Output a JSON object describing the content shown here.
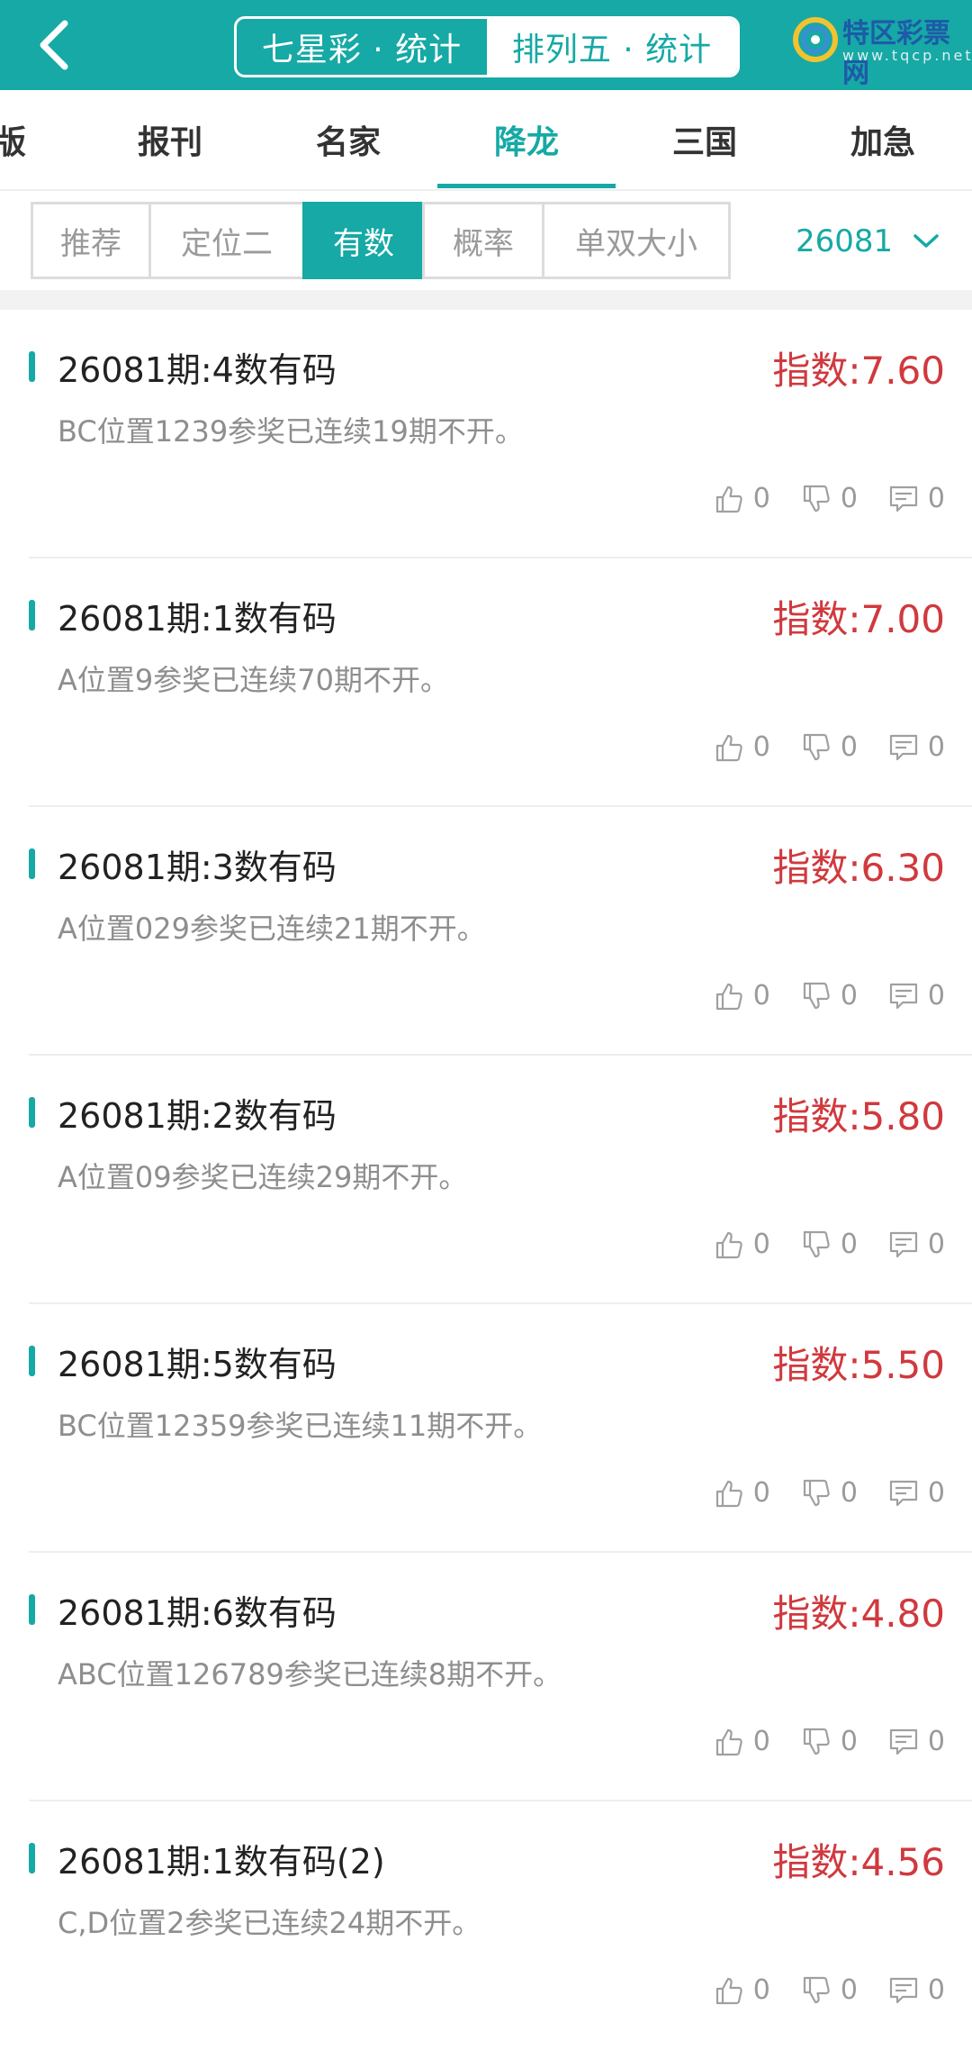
{
  "header": {
    "segments": [
      {
        "label": "七星彩 · 统计",
        "active": false
      },
      {
        "label": "排列五 · 统计",
        "active": true
      }
    ],
    "logo_text": "特区彩票网",
    "logo_sub": "www.tqcp.net"
  },
  "category_tabs": [
    {
      "label": "版",
      "active": false
    },
    {
      "label": "报刊",
      "active": false
    },
    {
      "label": "名家",
      "active": false
    },
    {
      "label": "降龙",
      "active": true
    },
    {
      "label": "三国",
      "active": false
    },
    {
      "label": "加急",
      "active": false
    }
  ],
  "sub_tabs": [
    {
      "label": "推荐",
      "active": false
    },
    {
      "label": "定位二",
      "active": false
    },
    {
      "label": "有数",
      "active": true
    },
    {
      "label": "概率",
      "active": false
    },
    {
      "label": "单双大小",
      "active": false
    }
  ],
  "period_select": {
    "value": "26081"
  },
  "colors": {
    "accent": "#16a9a5",
    "index_red": "#d0393e"
  },
  "items": [
    {
      "title": "26081期:4数有码",
      "index": "指数:7.60",
      "desc": "BC位置1239参奖已连续19期不开。",
      "likes": "0",
      "dislikes": "0",
      "comments": "0"
    },
    {
      "title": "26081期:1数有码",
      "index": "指数:7.00",
      "desc": "A位置9参奖已连续70期不开。",
      "likes": "0",
      "dislikes": "0",
      "comments": "0"
    },
    {
      "title": "26081期:3数有码",
      "index": "指数:6.30",
      "desc": "A位置029参奖已连续21期不开。",
      "likes": "0",
      "dislikes": "0",
      "comments": "0"
    },
    {
      "title": "26081期:2数有码",
      "index": "指数:5.80",
      "desc": "A位置09参奖已连续29期不开。",
      "likes": "0",
      "dislikes": "0",
      "comments": "0"
    },
    {
      "title": "26081期:5数有码",
      "index": "指数:5.50",
      "desc": "BC位置12359参奖已连续11期不开。",
      "likes": "0",
      "dislikes": "0",
      "comments": "0"
    },
    {
      "title": "26081期:6数有码",
      "index": "指数:4.80",
      "desc": "ABC位置126789参奖已连续8期不开。",
      "likes": "0",
      "dislikes": "0",
      "comments": "0"
    },
    {
      "title": "26081期:1数有码(2)",
      "index": "指数:4.56",
      "desc": "C,D位置2参奖已连续24期不开。",
      "likes": "0",
      "dislikes": "0",
      "comments": "0"
    }
  ]
}
